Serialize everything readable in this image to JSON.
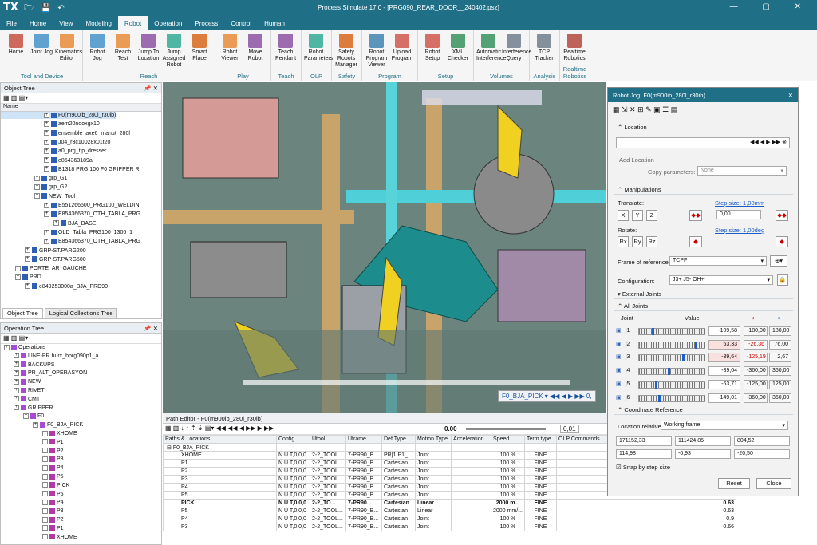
{
  "title_bar": {
    "logo": "TX",
    "title": "Process Simulate 17.0 - [PRG090_REAR_DOOR__240402.psz]"
  },
  "menu": [
    "File",
    "Home",
    "View",
    "Modeling",
    "Robot",
    "Operation",
    "Process",
    "Control",
    "Human"
  ],
  "menu_active": "Robot",
  "ribbon": {
    "groups": [
      {
        "label": "Tool and Device",
        "buttons": [
          "Home",
          "Joint Jog",
          "Kinematics Editor"
        ]
      },
      {
        "label": "Reach",
        "buttons": [
          "Robot Jog",
          "Reach Test",
          "Jump To Location",
          "Jump Assigned Robot",
          "Smart Place"
        ]
      },
      {
        "label": "Play",
        "buttons": [
          "Robot Viewer",
          "Move Robot"
        ]
      },
      {
        "label": "Teach",
        "buttons": [
          "Teach Pendant"
        ]
      },
      {
        "label": "OLP",
        "buttons": [
          "Robot Parameters"
        ]
      },
      {
        "label": "Safety",
        "buttons": [
          "Safety Robots Manager"
        ]
      },
      {
        "label": "Program",
        "buttons": [
          "Robot Program Viewer",
          "Upload Program"
        ]
      },
      {
        "label": "Setup",
        "buttons": [
          "Robot Setup",
          "XML Checker"
        ]
      },
      {
        "label": "Volumes",
        "buttons": [
          "Automatic Interference",
          "Interference Query"
        ]
      },
      {
        "label": "Analysis",
        "buttons": [
          "TCP Tracker"
        ]
      },
      {
        "label": "Realtime Robotics",
        "buttons": [
          "Realtime Robotics"
        ]
      }
    ]
  },
  "object_tree": {
    "title": "Object Tree",
    "column": "Name",
    "rows": [
      {
        "indent": 8,
        "label": "F0(m900ib_280l_r30ib)",
        "sel": true
      },
      {
        "indent": 8,
        "label": "aem20nooxgx10"
      },
      {
        "indent": 8,
        "label": "ensemble_axe6_manut_280l"
      },
      {
        "indent": 8,
        "label": "J04_r3c10028x01t20"
      },
      {
        "indent": 8,
        "label": "a0_prg_tip_dresser"
      },
      {
        "indent": 8,
        "label": "e854363189a"
      },
      {
        "indent": 8,
        "label": "B1318 PRG 100 F0 GRIPPER R"
      },
      {
        "indent": 6,
        "label": "grp_G1"
      },
      {
        "indent": 6,
        "label": "grp_G2"
      },
      {
        "indent": 6,
        "label": "NEW_Tool"
      },
      {
        "indent": 8,
        "label": "E551266500_PRG100_WELDIN"
      },
      {
        "indent": 8,
        "label": "E854366370_OTH_TABLA_PRG"
      },
      {
        "indent": 10,
        "label": "BJA_BASE"
      },
      {
        "indent": 8,
        "label": "OLD_Tabla_PRG100_1306_1"
      },
      {
        "indent": 8,
        "label": "E854366370_OTH_TABLA_PRG"
      },
      {
        "indent": 4,
        "label": "GRP-ST.PARG200"
      },
      {
        "indent": 4,
        "label": "GRP-ST.PARG500"
      },
      {
        "indent": 2,
        "label": "PORTE_AR_GAUCHE"
      },
      {
        "indent": 2,
        "label": "PRD"
      },
      {
        "indent": 4,
        "label": "e849253000a_BJA_PRD90"
      }
    ],
    "tabs": [
      "Object Tree",
      "Logical Collections Tree"
    ]
  },
  "operation_tree": {
    "title": "Operation Tree",
    "rows": [
      {
        "indent": 0,
        "label": "Operations"
      },
      {
        "indent": 2,
        "label": "LINE-PR.burx_bprg090p1_a"
      },
      {
        "indent": 2,
        "label": "BACKUPS"
      },
      {
        "indent": 2,
        "label": "PR_ALT_OPERASYON"
      },
      {
        "indent": 2,
        "label": "NEW"
      },
      {
        "indent": 2,
        "label": "RIVET"
      },
      {
        "indent": 2,
        "label": "CMT"
      },
      {
        "indent": 2,
        "label": "GRIPPER"
      },
      {
        "indent": 4,
        "label": "F0"
      },
      {
        "indent": 6,
        "label": "F0_BJA_PICK"
      },
      {
        "indent": 8,
        "label": "XHOME"
      },
      {
        "indent": 8,
        "label": "P1"
      },
      {
        "indent": 8,
        "label": "P2"
      },
      {
        "indent": 8,
        "label": "P3"
      },
      {
        "indent": 8,
        "label": "P4"
      },
      {
        "indent": 8,
        "label": "P5"
      },
      {
        "indent": 8,
        "label": "PICK"
      },
      {
        "indent": 8,
        "label": "P5"
      },
      {
        "indent": 8,
        "label": "P4"
      },
      {
        "indent": 8,
        "label": "P3"
      },
      {
        "indent": 8,
        "label": "P2"
      },
      {
        "indent": 8,
        "label": "P1"
      },
      {
        "indent": 8,
        "label": "XHOME"
      }
    ]
  },
  "viewer": {
    "sim_label": "F0_BJA_PICK",
    "time": "0,"
  },
  "path_editor": {
    "title": "Path Editor - F0(m900ib_280l_r30ib)",
    "time_value": "0.00",
    "step_value": "0,01",
    "columns": [
      "Paths & Locations",
      "Config",
      "Utool",
      "Uframe",
      "Def Type",
      "Motion Type",
      "Acceleration",
      "Speed",
      "Term type",
      "OLP Commands"
    ],
    "group": "F0_BJA_PICK",
    "rows": [
      {
        "name": "XHOME",
        "config": "N U T,0,0,0",
        "utool": "2-2_TOOL...",
        "uframe": "7-PR90_B...",
        "def": "PR[1:P1_...",
        "motion": "Joint",
        "accel": "",
        "speed": "100 %",
        "term": "FINE",
        "extra": ""
      },
      {
        "name": "P1",
        "config": "N U T,0,0,0",
        "utool": "2-2_TOOL...",
        "uframe": "7-PR90_B...",
        "def": "Cartesian",
        "motion": "Joint",
        "accel": "",
        "speed": "100 %",
        "term": "FINE",
        "extra": ""
      },
      {
        "name": "P2",
        "config": "N U T,0,0,0",
        "utool": "2-2_TOOL...",
        "uframe": "7-PR90_B...",
        "def": "Cartesian",
        "motion": "Joint",
        "accel": "",
        "speed": "100 %",
        "term": "FINE",
        "extra": ""
      },
      {
        "name": "P3",
        "config": "N U T,0,0,0",
        "utool": "2-2_TOOL...",
        "uframe": "7-PR90_B...",
        "def": "Cartesian",
        "motion": "Joint",
        "accel": "",
        "speed": "100 %",
        "term": "FINE",
        "extra": ""
      },
      {
        "name": "P4",
        "config": "N U T,0,0,0",
        "utool": "2-2_TOOL...",
        "uframe": "7-PR90_B...",
        "def": "Cartesian",
        "motion": "Joint",
        "accel": "",
        "speed": "100 %",
        "term": "FINE",
        "extra": "0.17"
      },
      {
        "name": "P5",
        "config": "N U T,0,0,0",
        "utool": "2-2_TOOL...",
        "uframe": "7-PR90_B...",
        "def": "Cartesian",
        "motion": "Joint",
        "accel": "",
        "speed": "100 %",
        "term": "FINE",
        "extra": "0.17"
      },
      {
        "name": "PICK",
        "config": "N U T,0,0,0",
        "utool": "2-2_TO...",
        "uframe": "7-PR90...",
        "def": "Cartesian",
        "motion": "Linear",
        "accel": "",
        "speed": "2000 m...",
        "term": "FINE",
        "extra": "0.63",
        "bold": true
      },
      {
        "name": "P5",
        "config": "N U T,0,0,0",
        "utool": "2-2_TOOL...",
        "uframe": "7-PR90_B...",
        "def": "Cartesian",
        "motion": "Linear",
        "accel": "",
        "speed": "2000 mm/...",
        "term": "FINE",
        "extra": "0.63"
      },
      {
        "name": "P4",
        "config": "N U T,0,0,0",
        "utool": "2-2_TOOL...",
        "uframe": "7-PR90_B...",
        "def": "Cartesian",
        "motion": "Joint",
        "accel": "",
        "speed": "100 %",
        "term": "FINE",
        "extra": "0.9"
      },
      {
        "name": "P3",
        "config": "N U T,0,0,0",
        "utool": "2-2_TOOL...",
        "uframe": "7-PR90_B...",
        "def": "Cartesian",
        "motion": "Joint",
        "accel": "",
        "speed": "100 %",
        "term": "FINE",
        "extra": "0.66"
      }
    ]
  },
  "robot_jog": {
    "title": "Robot Jog: F0(m900ib_280l_r30ib)",
    "location_label": "Location",
    "add_location": "Add Location",
    "copy_params": "Copy parameters:",
    "copy_value": "None",
    "manipulations": "Manipulations",
    "translate": "Translate:",
    "step_t": "Step size: 1,00mm",
    "translate_value": "0,00",
    "rotate": "Rotate:",
    "step_r": "Step size: 1,00deg",
    "axes_t": [
      "X",
      "Y",
      "Z"
    ],
    "axes_r": [
      "Rx",
      "Ry",
      "Rz"
    ],
    "frame_label": "Frame of reference:",
    "frame_value": "TCPF",
    "config_label": "Configuration:",
    "config_value": "J3+ J5- OH+",
    "external_joints": "External Joints",
    "all_joints": "All Joints",
    "joint_col": "Joint",
    "value_col": "Value",
    "joints": [
      {
        "name": "j1",
        "value": "-109,58",
        "min": "-180,00",
        "max": "180,00",
        "frac": 0.2,
        "red": false
      },
      {
        "name": "j2",
        "value": "63,33",
        "min": "-26,36",
        "max": "76,00",
        "frac": 0.87,
        "red": true
      },
      {
        "name": "j3",
        "value": "-39,64",
        "min": "-125,19",
        "max": "2,67",
        "frac": 0.67,
        "red": true
      },
      {
        "name": "j4",
        "value": "-39,04",
        "min": "-360,00",
        "max": "360,00",
        "frac": 0.45,
        "red": false
      },
      {
        "name": "j5",
        "value": "-63,71",
        "min": "-125,00",
        "max": "125,00",
        "frac": 0.25,
        "red": false
      },
      {
        "name": "j6",
        "value": "-149,01",
        "min": "-360,00",
        "max": "360,00",
        "frac": 0.3,
        "red": false
      }
    ],
    "coord_ref": "Coordinate Reference",
    "loc_rel_label": "Location relative:",
    "loc_rel_value": "Working frame",
    "coords": [
      "171152,33",
      "111424,85",
      "804,52",
      "114,98",
      "-0,93",
      "-20,50"
    ],
    "snap": "Snap by step size",
    "reset": "Reset",
    "close": "Close"
  }
}
